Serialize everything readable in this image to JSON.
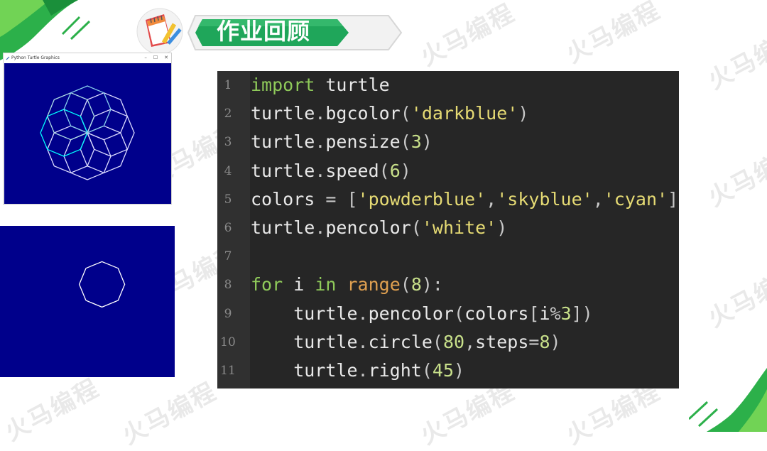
{
  "slide": {
    "title": "作业回顾",
    "watermark": "火马编程"
  },
  "turtle_window": {
    "title": "Python Turtle Graphics",
    "controls": [
      "–",
      "☐",
      "✕"
    ],
    "bg_color": "#00008b"
  },
  "editor": {
    "lines": [
      {
        "num": "1",
        "tokens": [
          {
            "t": "import",
            "c": "kw"
          },
          {
            "t": " turtle",
            "c": ""
          }
        ]
      },
      {
        "num": "2",
        "tokens": [
          {
            "t": "turtle",
            "c": ""
          },
          {
            "t": ".",
            "c": "op"
          },
          {
            "t": "bgcolor",
            "c": ""
          },
          {
            "t": "(",
            "c": "op"
          },
          {
            "t": "'darkblue'",
            "c": "str"
          },
          {
            "t": ")",
            "c": "op"
          }
        ]
      },
      {
        "num": "3",
        "tokens": [
          {
            "t": "turtle",
            "c": ""
          },
          {
            "t": ".",
            "c": "op"
          },
          {
            "t": "pensize",
            "c": ""
          },
          {
            "t": "(",
            "c": "op"
          },
          {
            "t": "3",
            "c": "num"
          },
          {
            "t": ")",
            "c": "op"
          }
        ]
      },
      {
        "num": "4",
        "tokens": [
          {
            "t": "turtle",
            "c": ""
          },
          {
            "t": ".",
            "c": "op"
          },
          {
            "t": "speed",
            "c": ""
          },
          {
            "t": "(",
            "c": "op"
          },
          {
            "t": "6",
            "c": "num"
          },
          {
            "t": ")",
            "c": "op"
          }
        ]
      },
      {
        "num": "5",
        "tokens": [
          {
            "t": "colors ",
            "c": ""
          },
          {
            "t": "=",
            "c": "op"
          },
          {
            "t": " [",
            "c": "op"
          },
          {
            "t": "'powderblue'",
            "c": "str"
          },
          {
            "t": ",",
            "c": "op"
          },
          {
            "t": "'skyblue'",
            "c": "str"
          },
          {
            "t": ",",
            "c": "op"
          },
          {
            "t": "'cyan'",
            "c": "str"
          },
          {
            "t": "]",
            "c": "op"
          }
        ]
      },
      {
        "num": "6",
        "tokens": [
          {
            "t": "turtle",
            "c": ""
          },
          {
            "t": ".",
            "c": "op"
          },
          {
            "t": "pencolor",
            "c": ""
          },
          {
            "t": "(",
            "c": "op"
          },
          {
            "t": "'white'",
            "c": "str"
          },
          {
            "t": ")",
            "c": "op"
          }
        ]
      },
      {
        "num": "7",
        "tokens": []
      },
      {
        "num": "8",
        "tokens": [
          {
            "t": "for",
            "c": "kw"
          },
          {
            "t": " i ",
            "c": ""
          },
          {
            "t": "in",
            "c": "kw"
          },
          {
            "t": " ",
            "c": ""
          },
          {
            "t": "range",
            "c": "fn"
          },
          {
            "t": "(",
            "c": "op"
          },
          {
            "t": "8",
            "c": "num"
          },
          {
            "t": "):",
            "c": "op"
          }
        ]
      },
      {
        "num": "9",
        "tokens": [
          {
            "t": "    turtle",
            "c": ""
          },
          {
            "t": ".",
            "c": "op"
          },
          {
            "t": "pencolor",
            "c": ""
          },
          {
            "t": "(",
            "c": "op"
          },
          {
            "t": "colors",
            "c": ""
          },
          {
            "t": "[",
            "c": "op"
          },
          {
            "t": "i",
            "c": ""
          },
          {
            "t": "%",
            "c": "op"
          },
          {
            "t": "3",
            "c": "num"
          },
          {
            "t": "])",
            "c": "op"
          }
        ]
      },
      {
        "num": "10",
        "tokens": [
          {
            "t": "    turtle",
            "c": ""
          },
          {
            "t": ".",
            "c": "op"
          },
          {
            "t": "circle",
            "c": ""
          },
          {
            "t": "(",
            "c": "op"
          },
          {
            "t": "80",
            "c": "num"
          },
          {
            "t": ",",
            "c": "op"
          },
          {
            "t": "steps",
            "c": ""
          },
          {
            "t": "=",
            "c": "op"
          },
          {
            "t": "8",
            "c": "num"
          },
          {
            "t": ")",
            "c": "op"
          }
        ]
      },
      {
        "num": "11",
        "tokens": [
          {
            "t": "    turtle",
            "c": ""
          },
          {
            "t": ".",
            "c": "op"
          },
          {
            "t": "right",
            "c": ""
          },
          {
            "t": "(",
            "c": "op"
          },
          {
            "t": "45",
            "c": "num"
          },
          {
            "t": ")",
            "c": "op"
          }
        ]
      }
    ]
  },
  "colors": {
    "accent_green": "#1fa65a",
    "editor_bg": "#262626",
    "canvas_bg": "#00008b"
  }
}
